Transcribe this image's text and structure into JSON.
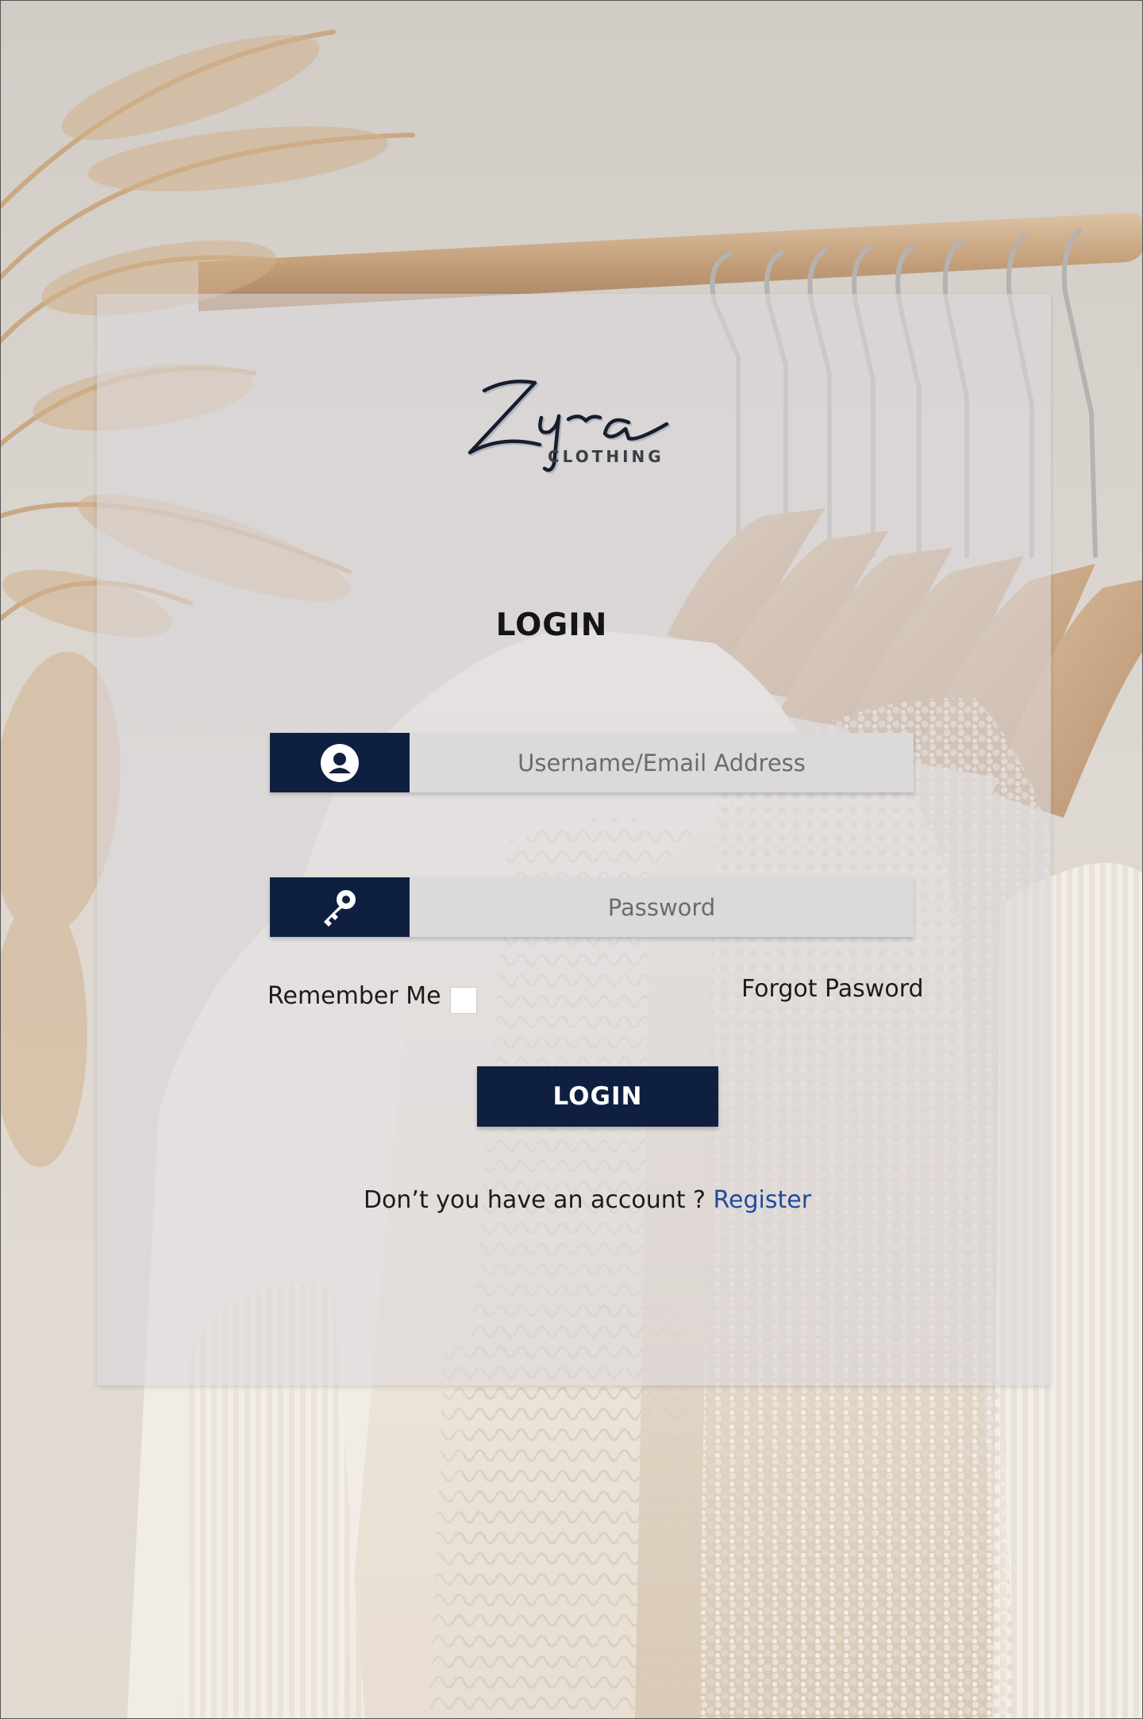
{
  "brand": {
    "logo_script": "Zyra",
    "logo_subtitle": "CLOTHING"
  },
  "form": {
    "heading": "LOGIN",
    "username": {
      "placeholder": "Username/Email Address",
      "value": "",
      "icon": "user-icon"
    },
    "password": {
      "placeholder": "Password",
      "value": "",
      "icon": "key-icon"
    },
    "remember_label": "Remember Me",
    "remember_checked": false,
    "forgot_label": "Forgot Pasword",
    "submit_label": "LOGIN",
    "register_prompt": "Don’t you have an account ?",
    "register_link": "Register"
  },
  "colors": {
    "navy": "#0f1f40",
    "input_bg": "#dadada",
    "link": "#1f4a9c",
    "panel": "rgba(218,216,218,0.58)"
  }
}
